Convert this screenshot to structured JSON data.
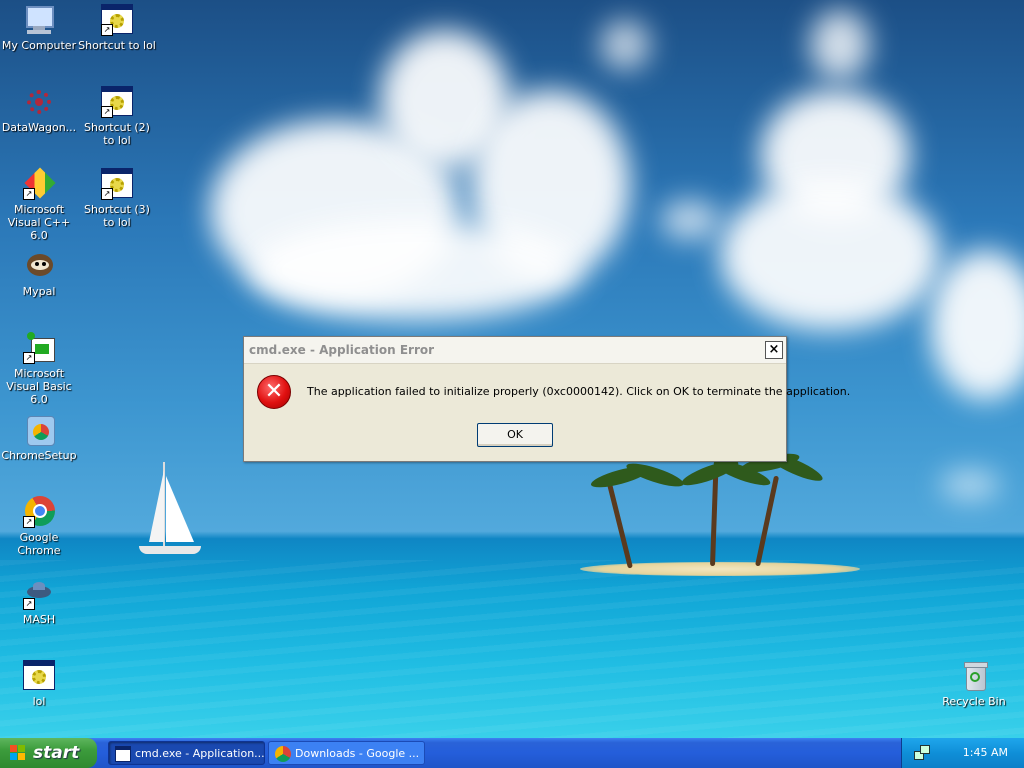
{
  "desktop": {
    "icons_left": [
      {
        "label": "My Computer",
        "icon": "my-computer-icon"
      },
      {
        "label": "DataWagon...",
        "icon": "datawagon-icon"
      },
      {
        "label": "Microsoft Visual C++ 6.0",
        "icon": "visual-cpp-icon"
      },
      {
        "label": "Mypal",
        "icon": "mypal-icon"
      },
      {
        "label": "Microsoft Visual Basic 6.0",
        "icon": "visual-basic-icon"
      },
      {
        "label": "ChromeSetup",
        "icon": "chrome-setup-icon"
      },
      {
        "label": "Google Chrome",
        "icon": "google-chrome-icon"
      },
      {
        "label": "MASH",
        "icon": "mash-icon"
      },
      {
        "label": "lol",
        "icon": "application-icon"
      }
    ],
    "icons_second": [
      {
        "label": "Shortcut to lol",
        "icon": "application-shortcut-icon"
      },
      {
        "label": "Shortcut (2) to lol",
        "icon": "application-shortcut-icon"
      },
      {
        "label": "Shortcut (3) to lol",
        "icon": "application-shortcut-icon"
      }
    ],
    "recycle_bin": {
      "label": "Recycle Bin",
      "icon": "recycle-bin-icon"
    }
  },
  "dialog": {
    "title": "cmd.exe - Application Error",
    "message": "The application failed to initialize properly (0xc0000142). Click on OK to terminate the application.",
    "ok_label": "OK",
    "close_glyph": "×",
    "icon": "error-icon"
  },
  "taskbar": {
    "start_label": "start",
    "tasks": [
      {
        "label": "cmd.exe - Application...",
        "icon": "window-icon",
        "active": true
      },
      {
        "label": "Downloads - Google ...",
        "icon": "chrome-icon",
        "active": false
      }
    ],
    "clock": "1:45 AM",
    "colors": {
      "taskbar": "#245edb",
      "start": "#3c9c3c",
      "tray": "#0f8fd8"
    }
  }
}
